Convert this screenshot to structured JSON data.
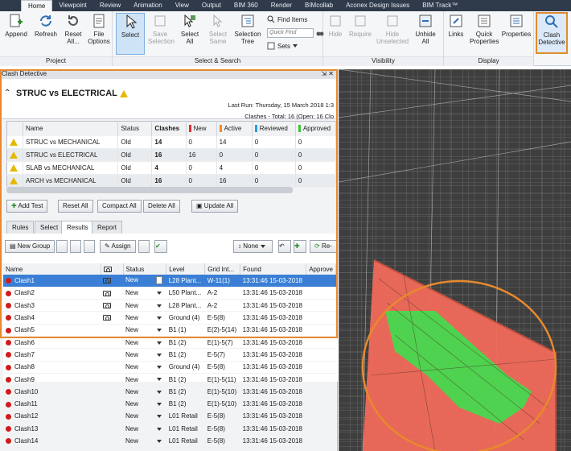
{
  "menu_tabs": [
    "Home",
    "Viewpoint",
    "Review",
    "Animation",
    "View",
    "Output",
    "BIM 360",
    "Render",
    "BIMcollab",
    "Aconex Design Issues",
    "BIM Track™"
  ],
  "ribbon": {
    "append": "Append",
    "refresh": "Refresh",
    "reset_all": "Reset All...",
    "file_options": "File Options",
    "project_group": "Project",
    "select": "Select",
    "save_selection": "Save Selection",
    "select_all": "Select All",
    "select_same": "Select Same",
    "selection_tree": "Selection Tree",
    "find_items": "Find Items",
    "quick_find_placeholder": "Quick Find",
    "sets": "Sets",
    "select_search_group": "Select & Search",
    "hide": "Hide",
    "require": "Require",
    "hide_unselected": "Hide Unselected",
    "unhide_all": "Unhide All",
    "visibility_group": "Visibility",
    "links": "Links",
    "quick_properties": "Quick Properties",
    "properties": "Properties",
    "display_group": "Display",
    "clash_detective": "Clash Detective"
  },
  "panel": {
    "title": "Clash Detective",
    "test_name": "STRUC vs ELECTRICAL",
    "last_run": "Last Run:  Thursday, 15 March 2018 1:3",
    "clashes_summary": "Clashes -  Total: 16  (Open:  16  Clo"
  },
  "tests_table": {
    "headers": [
      "Name",
      "Status",
      "Clashes",
      "New",
      "Active",
      "Reviewed",
      "Approved"
    ],
    "rows": [
      {
        "name": "STRUC vs MECHANICAL",
        "status": "Old",
        "clashes": "14",
        "new": "0",
        "active": "14",
        "reviewed": "0",
        "approved": "0"
      },
      {
        "name": "STRUC vs ELECTRICAL",
        "status": "Old",
        "clashes": "16",
        "new": "16",
        "active": "0",
        "reviewed": "0",
        "approved": "0"
      },
      {
        "name": "SLAB vs MECHANICAL",
        "status": "Old",
        "clashes": "4",
        "new": "0",
        "active": "4",
        "reviewed": "0",
        "approved": "0"
      },
      {
        "name": "ARCH vs MECHANICAL",
        "status": "Old",
        "clashes": "16",
        "new": "0",
        "active": "16",
        "reviewed": "0",
        "approved": "0"
      }
    ]
  },
  "buttons": {
    "add_test": "Add Test",
    "reset_all": "Reset All",
    "compact_all": "Compact All",
    "delete_all": "Delete All",
    "update_all": "Update All",
    "new_group": "New Group",
    "assign": "Assign",
    "none": "None",
    "rerun": "Re-"
  },
  "subtabs": [
    "Rules",
    "Select",
    "Results",
    "Report"
  ],
  "results_table": {
    "headers": [
      "Name",
      "",
      "Status",
      "Level",
      "Grid Int...",
      "Found",
      "Approve"
    ],
    "rows": [
      {
        "name": "Clash1",
        "status": "New",
        "level": "L28 Plant...",
        "grid": "W-11(1)",
        "found": "13:31:46 15-03-2018"
      },
      {
        "name": "Clash2",
        "status": "New",
        "level": "L50 Plant...",
        "grid": "A-2",
        "found": "13:31:46 15-03-2018"
      },
      {
        "name": "Clash3",
        "status": "New",
        "level": "L28 Plant...",
        "grid": "A-2",
        "found": "13:31:46 15-03-2018"
      },
      {
        "name": "Clash4",
        "status": "New",
        "level": "Ground (4)",
        "grid": "E-5(8)",
        "found": "13:31:46 15-03-2018"
      },
      {
        "name": "Clash5",
        "status": "New",
        "level": "B1 (1)",
        "grid": "E(2)-5(14)",
        "found": "13:31:46 15-03-2018"
      },
      {
        "name": "Clash6",
        "status": "New",
        "level": "B1 (2)",
        "grid": "E(1)-5(7)",
        "found": "13:31:46 15-03-2018"
      },
      {
        "name": "Clash7",
        "status": "New",
        "level": "B1 (2)",
        "grid": "E-5(7)",
        "found": "13:31:46 15-03-2018"
      },
      {
        "name": "Clash8",
        "status": "New",
        "level": "Ground (4)",
        "grid": "E-5(8)",
        "found": "13:31:46 15-03-2018"
      },
      {
        "name": "Clash9",
        "status": "New",
        "level": "B1 (2)",
        "grid": "E(1)-5(11)",
        "found": "13:31:46 15-03-2018"
      },
      {
        "name": "Clash10",
        "status": "New",
        "level": "B1 (2)",
        "grid": "E(1)-5(10)",
        "found": "13:31:46 15-03-2018"
      },
      {
        "name": "Clash11",
        "status": "New",
        "level": "B1 (2)",
        "grid": "E(1)-5(10)",
        "found": "13:31:46 15-03-2018"
      },
      {
        "name": "Clash12",
        "status": "New",
        "level": "L01 Retail",
        "grid": "E-5(8)",
        "found": "13:31:46 15-03-2018"
      },
      {
        "name": "Clash13",
        "status": "New",
        "level": "L01 Retail",
        "grid": "E-5(8)",
        "found": "13:31:46 15-03-2018"
      },
      {
        "name": "Clash14",
        "status": "New",
        "level": "L01 Retail",
        "grid": "E-5(8)",
        "found": "13:31:46 15-03-2018"
      }
    ]
  },
  "colors": {
    "accent_orange": "#e8892c",
    "selection_blue": "#3a7fd5",
    "clash_red": "#d11b1b",
    "new_bar": "#e03030",
    "active_bar": "#f08a24",
    "reviewed_bar": "#2a9de0",
    "approved_bar": "#3cc43c"
  }
}
